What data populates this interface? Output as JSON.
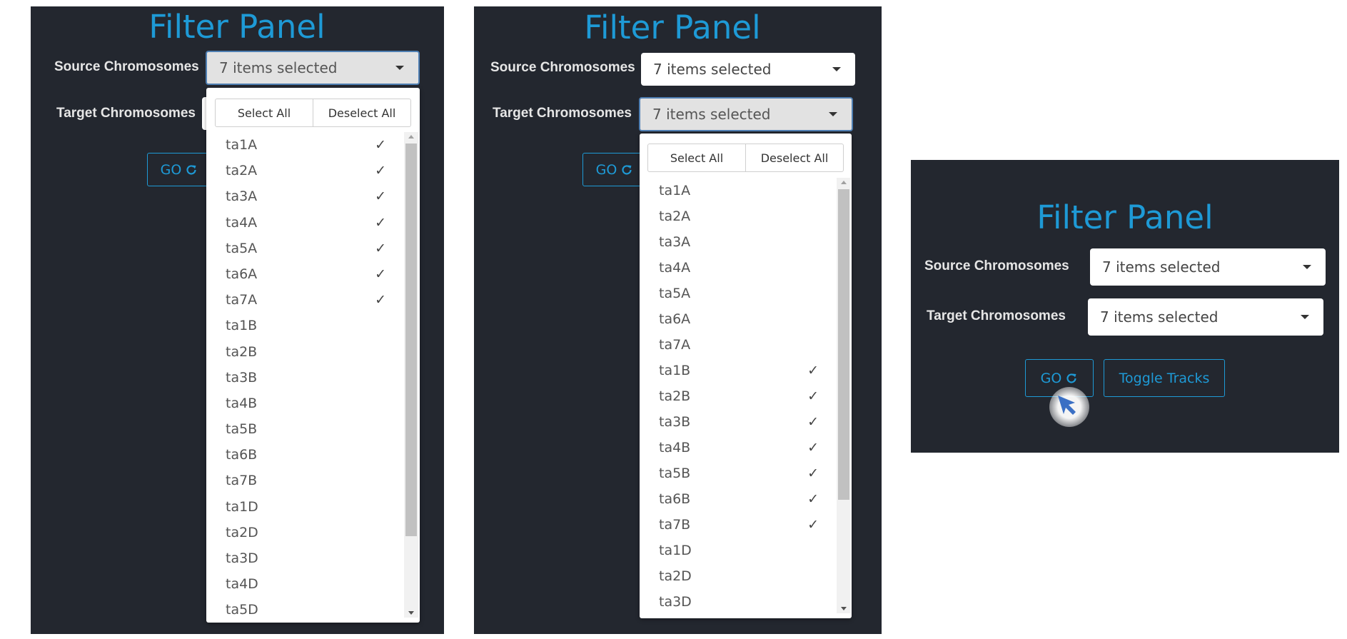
{
  "panel_title": "Filter Panel",
  "labels": {
    "source": "Source Chromosomes",
    "target": "Target Chromosomes"
  },
  "select_value": "7 items selected",
  "buttons": {
    "go": "GO",
    "toggle_tracks": "Toggle Tracks"
  },
  "dropdown_actions": {
    "select_all": "Select All",
    "deselect_all": "Deselect All"
  },
  "check_glyph": "✓",
  "icons": {
    "refresh": "refresh-icon",
    "caret": "caret-down-icon",
    "cursor": "mouse-pointer-icon"
  },
  "colors": {
    "panel_bg": "#23272f",
    "accent": "#1e9ad6",
    "active_border": "#4f7fb3",
    "cursor": "#3a6fc4"
  },
  "source_dropdown": {
    "items": [
      {
        "label": "ta1A",
        "checked": true
      },
      {
        "label": "ta2A",
        "checked": true
      },
      {
        "label": "ta3A",
        "checked": true
      },
      {
        "label": "ta4A",
        "checked": true
      },
      {
        "label": "ta5A",
        "checked": true
      },
      {
        "label": "ta6A",
        "checked": true
      },
      {
        "label": "ta7A",
        "checked": true
      },
      {
        "label": "ta1B",
        "checked": false
      },
      {
        "label": "ta2B",
        "checked": false
      },
      {
        "label": "ta3B",
        "checked": false
      },
      {
        "label": "ta4B",
        "checked": false
      },
      {
        "label": "ta5B",
        "checked": false
      },
      {
        "label": "ta6B",
        "checked": false
      },
      {
        "label": "ta7B",
        "checked": false
      },
      {
        "label": "ta1D",
        "checked": false
      },
      {
        "label": "ta2D",
        "checked": false
      },
      {
        "label": "ta3D",
        "checked": false
      },
      {
        "label": "ta4D",
        "checked": false
      },
      {
        "label": "ta5D",
        "checked": false
      }
    ]
  },
  "target_dropdown": {
    "items": [
      {
        "label": "ta1A",
        "checked": false
      },
      {
        "label": "ta2A",
        "checked": false
      },
      {
        "label": "ta3A",
        "checked": false
      },
      {
        "label": "ta4A",
        "checked": false
      },
      {
        "label": "ta5A",
        "checked": false
      },
      {
        "label": "ta6A",
        "checked": false
      },
      {
        "label": "ta7A",
        "checked": false
      },
      {
        "label": "ta1B",
        "checked": true
      },
      {
        "label": "ta2B",
        "checked": true
      },
      {
        "label": "ta3B",
        "checked": true
      },
      {
        "label": "ta4B",
        "checked": true
      },
      {
        "label": "ta5B",
        "checked": true
      },
      {
        "label": "ta6B",
        "checked": true
      },
      {
        "label": "ta7B",
        "checked": true
      },
      {
        "label": "ta1D",
        "checked": false
      },
      {
        "label": "ta2D",
        "checked": false
      },
      {
        "label": "ta3D",
        "checked": false
      }
    ]
  }
}
